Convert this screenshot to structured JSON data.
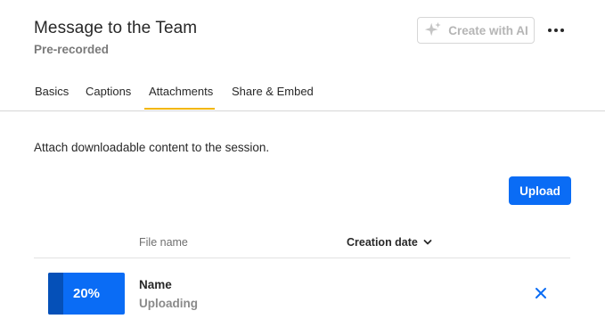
{
  "header": {
    "title": "Message to the Team",
    "subtitle": "Pre-recorded",
    "create_ai_label": "Create with AI"
  },
  "tabs": [
    {
      "label": "Basics"
    },
    {
      "label": "Captions"
    },
    {
      "label": "Attachments",
      "active": true
    },
    {
      "label": "Share & Embed"
    }
  ],
  "main": {
    "description": "Attach downloadable content to the session.",
    "upload_label": "Upload"
  },
  "table": {
    "columns": {
      "file_name": "File name",
      "creation_date": "Creation date"
    },
    "rows": [
      {
        "progress_text": "20%",
        "progress": 0.2,
        "name": "Name",
        "status": "Uploading"
      }
    ]
  },
  "colors": {
    "accent": "#0a6cf5",
    "tab_indicator": "#f2b600",
    "progress_fill": "#0550b8"
  },
  "icons": {
    "ai": "sparkle-icon",
    "more": "more-icon",
    "sort": "chevron-down-icon",
    "remove": "close-icon"
  }
}
